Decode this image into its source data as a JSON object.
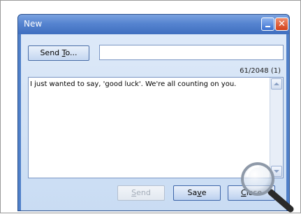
{
  "window": {
    "title": "New",
    "minimize_icon": "minimize-icon",
    "close_icon": "close-icon",
    "close_glyph": "✕"
  },
  "recipient": {
    "send_to_label_pre": "Send ",
    "send_to_label_u": "T",
    "send_to_label_post": "o...",
    "value": ""
  },
  "counter": "61/2048 (1)",
  "message": {
    "text": "I just wanted to say, 'good luck'. We're all counting on you."
  },
  "buttons": {
    "send_u": "S",
    "send_rest": "end",
    "save_pre": "Sa",
    "save_u": "v",
    "save_post": "e",
    "close_u": "C",
    "close_rest": "lose",
    "send_enabled": false
  },
  "overlay": {
    "icon": "magnifier-cursor-icon"
  }
}
